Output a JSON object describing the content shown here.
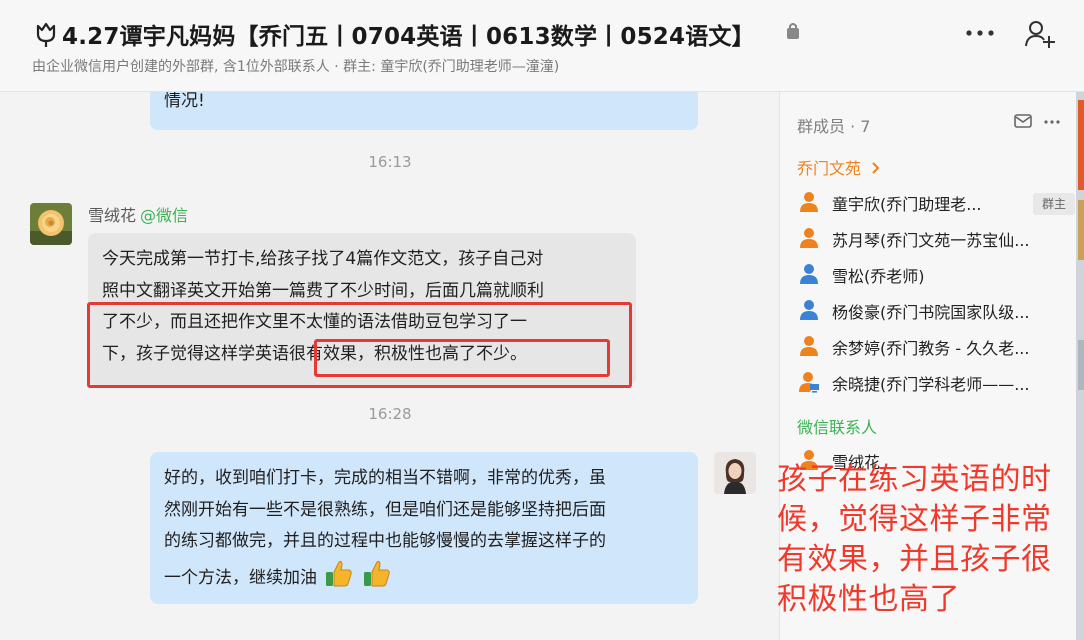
{
  "header": {
    "title": "4.27谭宇凡妈妈【乔门五丨0704英语丨0613数学丨0524语文】",
    "subtitle": "由企业微信用户创建的外部群, 含1位外部联系人 · 群主: 童宇欣(乔门助理老师—潼潼)"
  },
  "chat": {
    "previous_message_tail": "情况!",
    "time1": "16:13",
    "message1": {
      "sender": "雪绒花",
      "source": "@微信",
      "lines": [
        "今天完成第一节打卡,给孩子找了4篇作文范文，孩子自己对",
        "照中文翻译英文开始第一篇费了不少时间，后面几篇就顺利",
        "了不少，而且还把作文里不太懂的语法借助豆包学习了一",
        "下，孩子觉得这样学英语很有效果，积极性也高了不少。"
      ]
    },
    "time2": "16:28",
    "message2": {
      "lines": [
        "好的，收到咱们打卡，完成的相当不错啊，非常的优秀，虽",
        "然刚开始有一些不是很熟练，但是咱们还是能够坚持把后面",
        "的练习都做完，并且的过程中也能够慢慢的去掌握这样子的",
        "一个方法，继续加油"
      ]
    }
  },
  "members": {
    "title": "群成员 · 7",
    "org_section": "乔门文苑",
    "org_members": [
      {
        "name": "童宇欣(乔门助理老...",
        "badge": "群主",
        "color": "#f0821e"
      },
      {
        "name": "苏月琴(乔门文苑一苏宝仙...",
        "color": "#f0821e"
      },
      {
        "name": "雪松(乔老师)",
        "color": "#3b82d6"
      },
      {
        "name": "杨俊豪(乔门书院国家队级...",
        "color": "#3b82d6"
      },
      {
        "name": "余梦婷(乔门教务 - 久久老...",
        "color": "#f0821e"
      },
      {
        "name": "余晓捷(乔门学科老师——...",
        "color": "#f0821e"
      }
    ],
    "wx_section": "微信联系人",
    "wx_members": [
      {
        "name": "雪绒花"
      }
    ]
  },
  "annotation": {
    "text": "孩子在练习英语的时候，觉得这样子非常有效果，并且孩子很积极性也高了"
  },
  "colors": {
    "sent_bubble": "#cfe6fb",
    "received_bubble": "#e6e6e6",
    "highlight": "#e53935",
    "annotation": "#f0392b",
    "wechat_green": "#3db255",
    "org_orange": "#f0821e"
  },
  "icons": [
    "tulip-icon",
    "lock-icon",
    "more-icon",
    "add-member-icon",
    "mail-icon",
    "chevron-right-icon",
    "person-icon",
    "thumbs-up-icon"
  ]
}
